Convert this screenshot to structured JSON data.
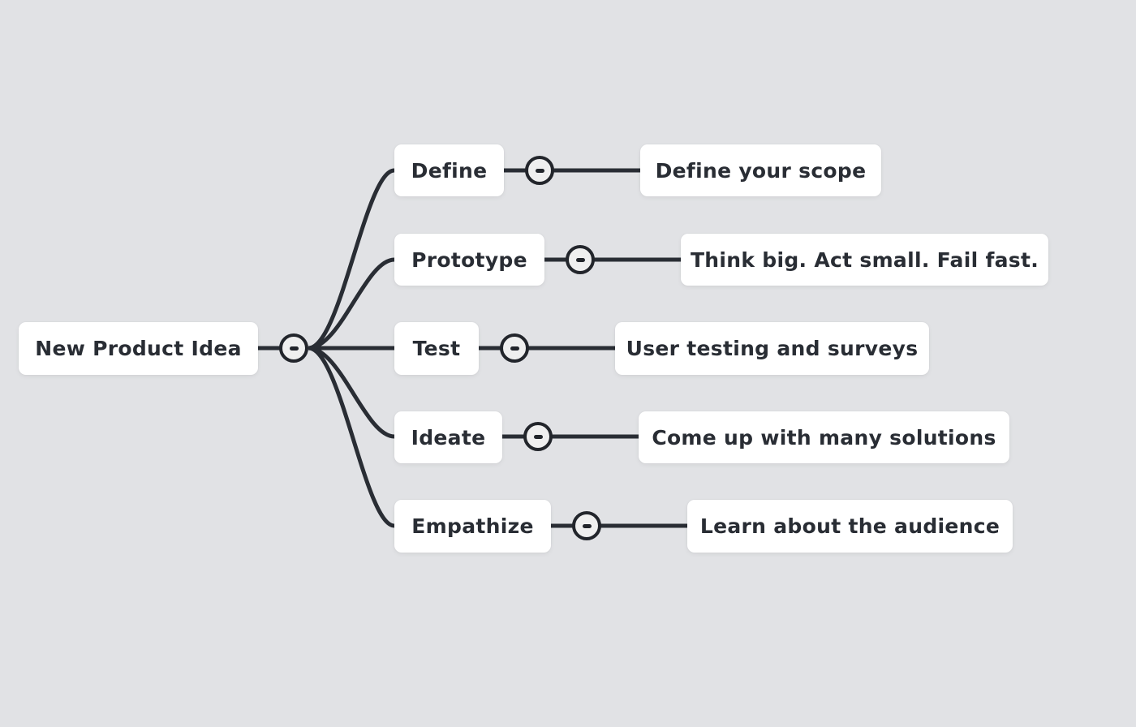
{
  "mindmap": {
    "root": {
      "label": "New Product Idea",
      "collapse_icon": "minus-circle-icon"
    },
    "branches": [
      {
        "label": "Define",
        "child": "Define your scope"
      },
      {
        "label": "Prototype",
        "child": "Think big. Act small. Fail fast."
      },
      {
        "label": "Test",
        "child": "User testing and surveys"
      },
      {
        "label": "Ideate",
        "child": "Come up with many solutions"
      },
      {
        "label": "Empathize",
        "child": "Learn about the audience"
      }
    ]
  },
  "colors": {
    "background": "#efefef",
    "grid_dot": "#e1e2e5",
    "node_fill": "#ffffff",
    "text": "#292d34",
    "line": "#292d34"
  }
}
